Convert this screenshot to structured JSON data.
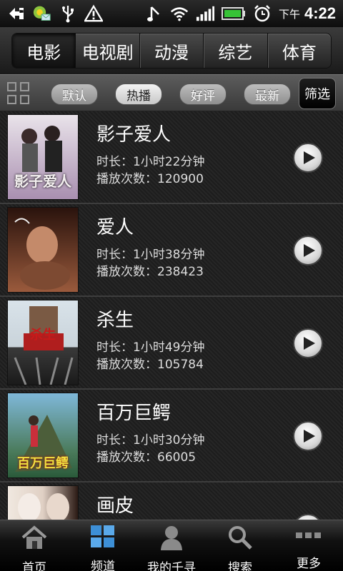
{
  "status_bar": {
    "ampm": "下午",
    "time": "4:22",
    "icons": [
      "add-icon",
      "app-notification-icon",
      "usb-icon",
      "warning-icon",
      "music-icon",
      "wifi-icon",
      "signal-icon",
      "battery-icon",
      "alarm-icon"
    ]
  },
  "category_tabs": [
    {
      "label": "电影",
      "active": true
    },
    {
      "label": "电视剧",
      "active": false
    },
    {
      "label": "动漫",
      "active": false
    },
    {
      "label": "综艺",
      "active": false
    },
    {
      "label": "体育",
      "active": false
    }
  ],
  "sort_bar": {
    "options": [
      {
        "label": "默认",
        "active": false
      },
      {
        "label": "热播",
        "active": true
      },
      {
        "label": "好评",
        "active": false
      },
      {
        "label": "最新",
        "active": false
      }
    ],
    "filter_label": "筛选"
  },
  "movies": [
    {
      "title": "影子爱人",
      "duration": "时长：1小时22分钟",
      "plays": "播放次数：120900",
      "poster_text": "影子爱人",
      "poster_colors": [
        "#e9e3ea",
        "#a98fb0"
      ]
    },
    {
      "title": "爱人",
      "duration": "时长：1小时38分钟",
      "plays": "播放次数：238423",
      "poster_text": "",
      "poster_colors": [
        "#2a130d",
        "#9a5a3c"
      ]
    },
    {
      "title": "杀生",
      "duration": "时长：1小时49分钟",
      "plays": "播放次数：105784",
      "poster_text": "杀生",
      "poster_colors": [
        "#d9e3ea",
        "#3a3a3a"
      ]
    },
    {
      "title": "百万巨鳄",
      "duration": "时长：1小时30分钟",
      "plays": "播放次数：66005",
      "poster_text": "百万巨鳄",
      "poster_colors": [
        "#7fb8d9",
        "#2a5a3a"
      ]
    },
    {
      "title": "画皮",
      "duration": "",
      "plays": "",
      "poster_text": "",
      "poster_colors": [
        "#efe7e0",
        "#2b1a14"
      ]
    }
  ],
  "bottom_nav": [
    {
      "label": "首页",
      "icon": "home-icon"
    },
    {
      "label": "频道",
      "icon": "channel-grid-icon"
    },
    {
      "label": "我的千寻",
      "icon": "user-icon"
    },
    {
      "label": "搜索",
      "icon": "search-icon"
    },
    {
      "label": "更多",
      "icon": "more-icon"
    }
  ]
}
